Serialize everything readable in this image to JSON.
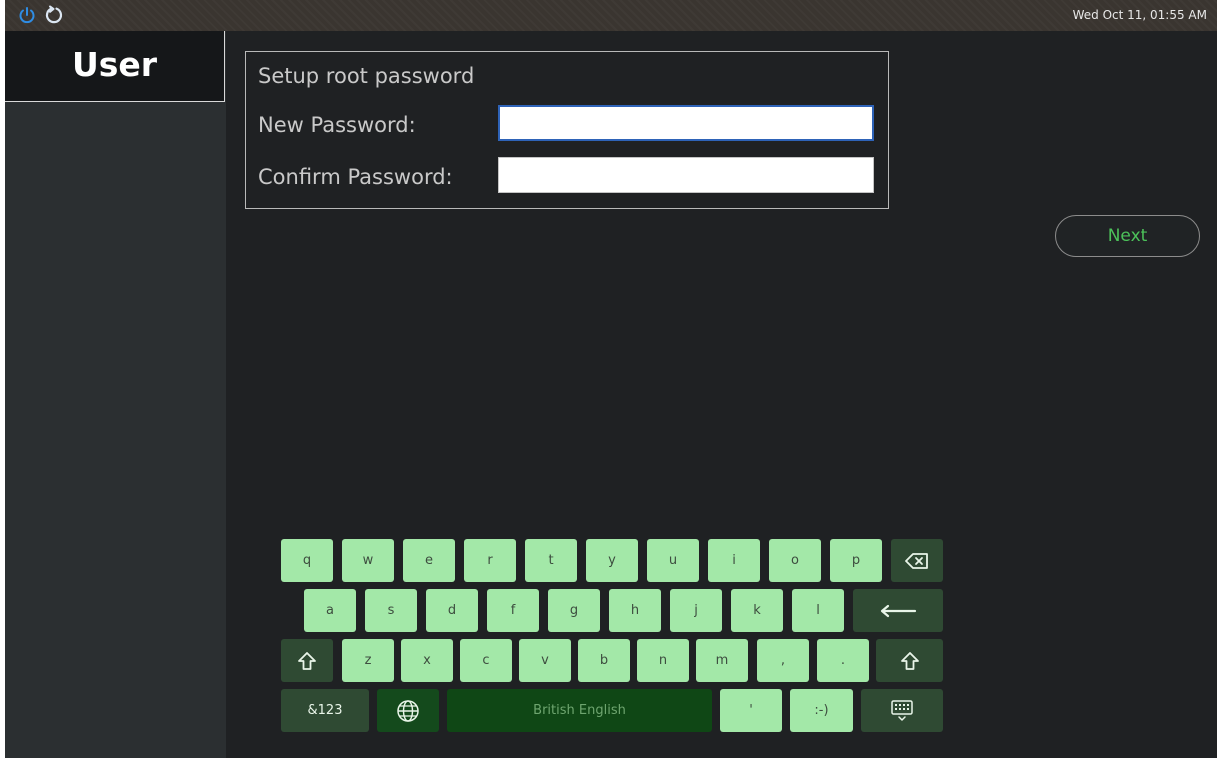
{
  "topbar": {
    "clock": "Wed Oct 11, 01:55 AM",
    "left_icons": [
      "power-icon",
      "restart-icon"
    ]
  },
  "sidebar": {
    "current_step": "User"
  },
  "form": {
    "title": "Setup root password",
    "new_password_label": "New Password:",
    "new_password_value": "",
    "confirm_password_label": "Confirm Password:",
    "confirm_password_value": ""
  },
  "next_button": {
    "label": "Next"
  },
  "keyboard": {
    "row1": [
      "q",
      "w",
      "e",
      "r",
      "t",
      "y",
      "u",
      "i",
      "o",
      "p"
    ],
    "row2": [
      "a",
      "s",
      "d",
      "f",
      "g",
      "h",
      "j",
      "k",
      "l"
    ],
    "row3": [
      "z",
      "x",
      "c",
      "v",
      "b",
      "n",
      "m",
      ",",
      "."
    ],
    "symbols_key": "&123",
    "space_label": "British English",
    "apostrophe_key": "'",
    "smiley_key": ":-)",
    "icons": [
      "backspace-icon",
      "enter-icon",
      "shift-icon",
      "globe-icon",
      "keyboard-hide-icon"
    ]
  },
  "colors": {
    "accent_green": "#4cc25a",
    "key_light": "#a3e8a8",
    "key_dark": "#2f4a33",
    "space_key": "#0f4715",
    "focus_blue": "#2e63b8"
  }
}
